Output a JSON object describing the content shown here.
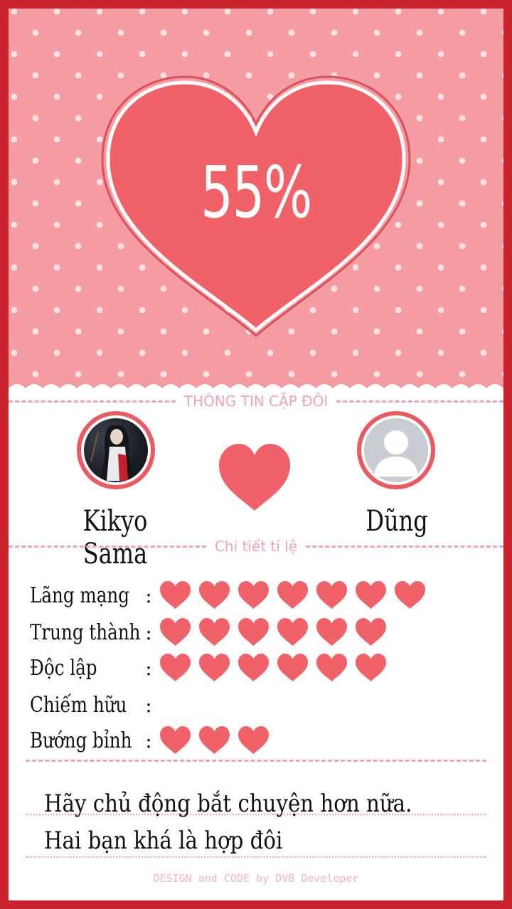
{
  "result": {
    "percent": "55%"
  },
  "couple_section": {
    "title": "THÔNG TIN CẶP ĐÔI"
  },
  "person1": {
    "name": "Kikyo Sama"
  },
  "person2": {
    "name": "Dũng"
  },
  "ratio_section": {
    "title": "Chi tiết tỉ lệ"
  },
  "stats": [
    {
      "label": "Lãng mạng",
      "hearts": 7
    },
    {
      "label": "Trung thành",
      "hearts": 6
    },
    {
      "label": "Độc lập",
      "hearts": 6
    },
    {
      "label": "Chiếm hữu",
      "hearts": 0
    },
    {
      "label": "Bướng bỉnh",
      "hearts": 3
    }
  ],
  "advice": "Hãy chủ động bắt chuyện hơn nữa. Hai bạn khá là hợp đôi",
  "footer": "DESIGN and CODE by DVB Developer",
  "colors": {
    "frame": "#c9232b",
    "heart": "#f06268",
    "pink_bg": "#f49ca2",
    "dashed": "#f1a5b1"
  }
}
